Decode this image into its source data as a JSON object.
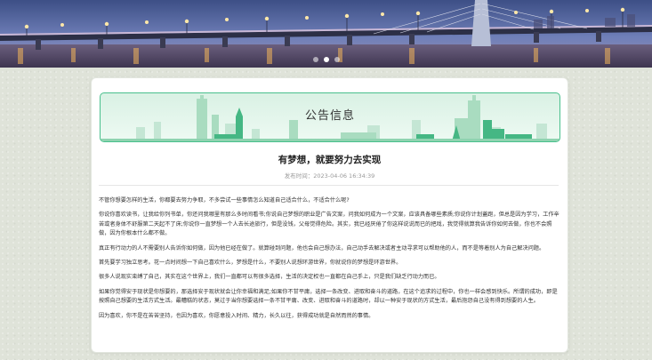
{
  "hero": {
    "slides": 3,
    "active_slide": 2,
    "image": "city-bridge-night-photo"
  },
  "notice_banner": {
    "title": "公告信息"
  },
  "article": {
    "title": "有梦想，就要努力去实现",
    "meta_label": "发布时间：",
    "meta_value": "2023-04-06 16:34:39",
    "paragraphs": [
      "不管你想要怎样的生活，你都要去努力争取，不多尝试一些事情怎么知道自己适合什么，不适合什么呢?",
      "你说你喜欢读书，让我给你列书单，你还问我哪里有那么多时间看书;你说自己梦想的职业是广告文案，问我如何成为一个文案，应该具备哪些素质;你说你计划蓋跑，但总是因为学习，工作辛苦或者身体不舒服第二天起不了床;你说你一直梦想一个人去长途旅行，但是没钱，父母觉得危险。其实，我已经厌倦了你这样说说而已的把戏，我觉得就算我告诉你如何去做，你也不会照做，因为你根本什么都不做。",
      "真正有行动力的人不需要别人告诉你如何做，因为他已经在做了。就算碰到问题，他也会自己想办法，自己动手去解决或者主动寻求可以帮助他的人，而不是等着别人为自己解决问题。",
      "首先要学习独立思考。花一点时间想一下自己喜欢什么，梦想是什么，不要别人说想环游世界，你就说你的梦想是环游世界。",
      "很多人说现实束缚了自己，其实在这个世界上，我们一直都可以有很多选择，生活的决定权也一直都在自己手上，只是我们缺乏行动力而已。",
      "如果你觉得安于现状是你想要的，那选择安于现状就会让你幸福和满足;如果你不甘平庸，选择一条改变、进取和奋斗的道路，在这个追求的过程中，你也一样会感到快乐。所谓的成功，即是按照自己想要的生活方式生活。最糟糕的状态，莫过于当你想要选择一条不甘平庸、改变、进取和奋斗的道路时，却以一种安于现状的方式生活，最后抱怨自己没有得到想要的人生。",
      "因为喜欢，你不是在苦苦坚持，也因为喜欢，你愿意投入时间、精力，长久以往，获得成功就是自然而然的事情。"
    ]
  },
  "colors": {
    "accent": "#49c08d",
    "page_bg": "#dfe3d9",
    "text": "#333333"
  }
}
